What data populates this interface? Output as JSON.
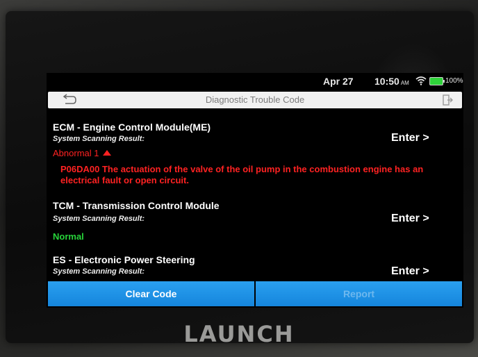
{
  "device": {
    "brand": "LAUNCH"
  },
  "statusbar": {
    "date": "Apr 27",
    "time": "10:50",
    "ampm": "AM",
    "battery": "100%",
    "icons": [
      "wifi-icon",
      "battery-icon"
    ]
  },
  "titlebar": {
    "title": "Diagnostic Trouble Code",
    "icons": [
      "back-arrow-icon",
      "exit-icon"
    ]
  },
  "modules": [
    {
      "name": "ECM - Engine Control Module(ME)",
      "result_label": "System Scanning Result:",
      "status": "Abnormal 1",
      "enter": "Enter >",
      "dtc": "P06DA00 The actuation of the valve of the oil pump in the combustion engine has an electrical fault or open circuit."
    },
    {
      "name": "TCM - Transmission Control Module",
      "result_label": "System Scanning Result:",
      "status": "Normal",
      "enter": "Enter >"
    },
    {
      "name": "ES - Electronic Power Steering",
      "result_label": "System Scanning Result:",
      "enter": "Enter >"
    }
  ],
  "buttons": {
    "clear": "Clear Code",
    "report": "Report"
  },
  "colors": {
    "abnormal": "#ff2222",
    "normal": "#27d33a",
    "button": "#1a8ee6",
    "titlebar": "#f1f1f1"
  }
}
